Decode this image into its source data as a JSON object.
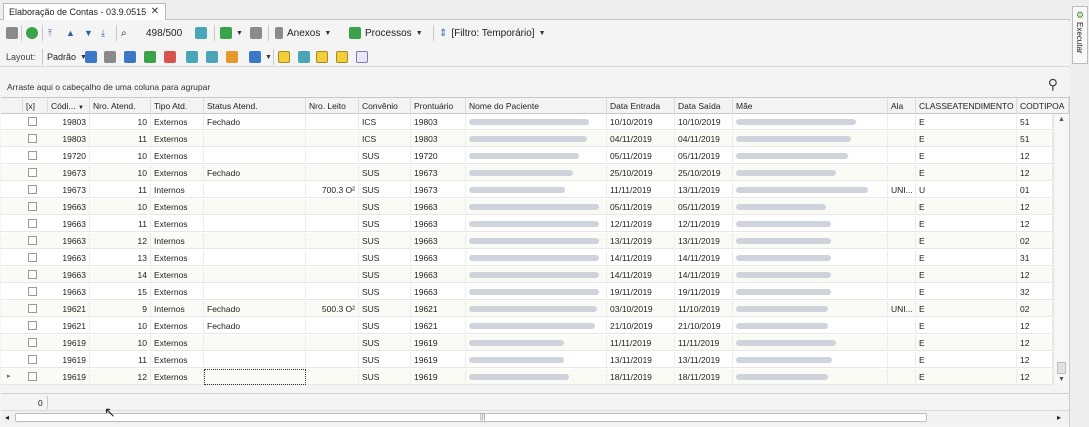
{
  "tab": {
    "title": "Elaboração de Contas - 03.9.0515",
    "close": "✕"
  },
  "toolbar1": {
    "record_count": "498/500",
    "anexos": "Anexos",
    "processos": "Processos",
    "filter": "[Filtro: Temporário]"
  },
  "toolbar2": {
    "layout_label": "Layout:",
    "layout_value": "Padrão"
  },
  "group_panel": {
    "text": "Arraste aqui o cabeçalho de uma coluna para agrupar"
  },
  "columns": [
    "[x]",
    "Códi...",
    "Nro. Atend.",
    "Tipo Atd.",
    "Status Atend.",
    "Nro. Leito",
    "Convênio",
    "Prontuário",
    "Nome do Paciente",
    "Data Entrada",
    "Data Saída",
    "Mãe",
    "Ala",
    "CLASSEATENDIMENTO",
    "CODTIPOA"
  ],
  "rows": [
    {
      "codigo": "19803",
      "nro": "10",
      "tipo": "Externos",
      "status": "Fechado",
      "leito": "",
      "convenio": "ICS",
      "prontuario": "19803",
      "entrada": "10/10/2019",
      "saida": "10/10/2019",
      "ala": "",
      "classe": "E",
      "codtipo": "51"
    },
    {
      "codigo": "19803",
      "nro": "11",
      "tipo": "Externos",
      "status": "",
      "leito": "",
      "convenio": "ICS",
      "prontuario": "19803",
      "entrada": "04/11/2019",
      "saida": "04/11/2019",
      "ala": "",
      "classe": "E",
      "codtipo": "51"
    },
    {
      "codigo": "19720",
      "nro": "10",
      "tipo": "Externos",
      "status": "",
      "leito": "",
      "convenio": "SUS",
      "prontuario": "19720",
      "entrada": "05/11/2019",
      "saida": "05/11/2019",
      "ala": "",
      "classe": "E",
      "codtipo": "12"
    },
    {
      "codigo": "19673",
      "nro": "10",
      "tipo": "Externos",
      "status": "Fechado",
      "leito": "",
      "convenio": "SUS",
      "prontuario": "19673",
      "entrada": "25/10/2019",
      "saida": "25/10/2019",
      "ala": "",
      "classe": "E",
      "codtipo": "12"
    },
    {
      "codigo": "19673",
      "nro": "11",
      "tipo": "Internos",
      "status": "",
      "leito": "700.3 O²",
      "convenio": "SUS",
      "prontuario": "19673",
      "entrada": "11/11/2019",
      "saida": "13/11/2019",
      "ala": "UNI...",
      "classe": "U",
      "codtipo": "01"
    },
    {
      "codigo": "19663",
      "nro": "10",
      "tipo": "Externos",
      "status": "",
      "leito": "",
      "convenio": "SUS",
      "prontuario": "19663",
      "entrada": "05/11/2019",
      "saida": "05/11/2019",
      "ala": "",
      "classe": "E",
      "codtipo": "12"
    },
    {
      "codigo": "19663",
      "nro": "11",
      "tipo": "Externos",
      "status": "",
      "leito": "",
      "convenio": "SUS",
      "prontuario": "19663",
      "entrada": "12/11/2019",
      "saida": "12/11/2019",
      "ala": "",
      "classe": "E",
      "codtipo": "12"
    },
    {
      "codigo": "19663",
      "nro": "12",
      "tipo": "Internos",
      "status": "",
      "leito": "",
      "convenio": "SUS",
      "prontuario": "19663",
      "entrada": "13/11/2019",
      "saida": "13/11/2019",
      "ala": "",
      "classe": "E",
      "codtipo": "02"
    },
    {
      "codigo": "19663",
      "nro": "13",
      "tipo": "Externos",
      "status": "",
      "leito": "",
      "convenio": "SUS",
      "prontuario": "19663",
      "entrada": "14/11/2019",
      "saida": "14/11/2019",
      "ala": "",
      "classe": "E",
      "codtipo": "31"
    },
    {
      "codigo": "19663",
      "nro": "14",
      "tipo": "Externos",
      "status": "",
      "leito": "",
      "convenio": "SUS",
      "prontuario": "19663",
      "entrada": "14/11/2019",
      "saida": "14/11/2019",
      "ala": "",
      "classe": "E",
      "codtipo": "12"
    },
    {
      "codigo": "19663",
      "nro": "15",
      "tipo": "Externos",
      "status": "",
      "leito": "",
      "convenio": "SUS",
      "prontuario": "19663",
      "entrada": "19/11/2019",
      "saida": "19/11/2019",
      "ala": "",
      "classe": "E",
      "codtipo": "32"
    },
    {
      "codigo": "19621",
      "nro": "9",
      "tipo": "Internos",
      "status": "Fechado",
      "leito": "500.3 O²",
      "convenio": "SUS",
      "prontuario": "19621",
      "entrada": "03/10/2019",
      "saida": "11/10/2019",
      "ala": "UNI...",
      "classe": "E",
      "codtipo": "02"
    },
    {
      "codigo": "19621",
      "nro": "10",
      "tipo": "Externos",
      "status": "Fechado",
      "leito": "",
      "convenio": "SUS",
      "prontuario": "19621",
      "entrada": "21/10/2019",
      "saida": "21/10/2019",
      "ala": "",
      "classe": "E",
      "codtipo": "12"
    },
    {
      "codigo": "19619",
      "nro": "10",
      "tipo": "Externos",
      "status": "",
      "leito": "",
      "convenio": "SUS",
      "prontuario": "19619",
      "entrada": "11/11/2019",
      "saida": "11/11/2019",
      "ala": "",
      "classe": "E",
      "codtipo": "12"
    },
    {
      "codigo": "19619",
      "nro": "11",
      "tipo": "Externos",
      "status": "",
      "leito": "",
      "convenio": "SUS",
      "prontuario": "19619",
      "entrada": "13/11/2019",
      "saida": "13/11/2019",
      "ala": "",
      "classe": "E",
      "codtipo": "12"
    },
    {
      "codigo": "19619",
      "nro": "12",
      "tipo": "Externos",
      "status": "",
      "leito": "",
      "convenio": "SUS",
      "prontuario": "19619",
      "entrada": "18/11/2019",
      "saida": "18/11/2019",
      "ala": "",
      "classe": "E",
      "codtipo": "12"
    }
  ],
  "footer": {
    "count": "0"
  },
  "side_panel": {
    "label": "Executar"
  }
}
